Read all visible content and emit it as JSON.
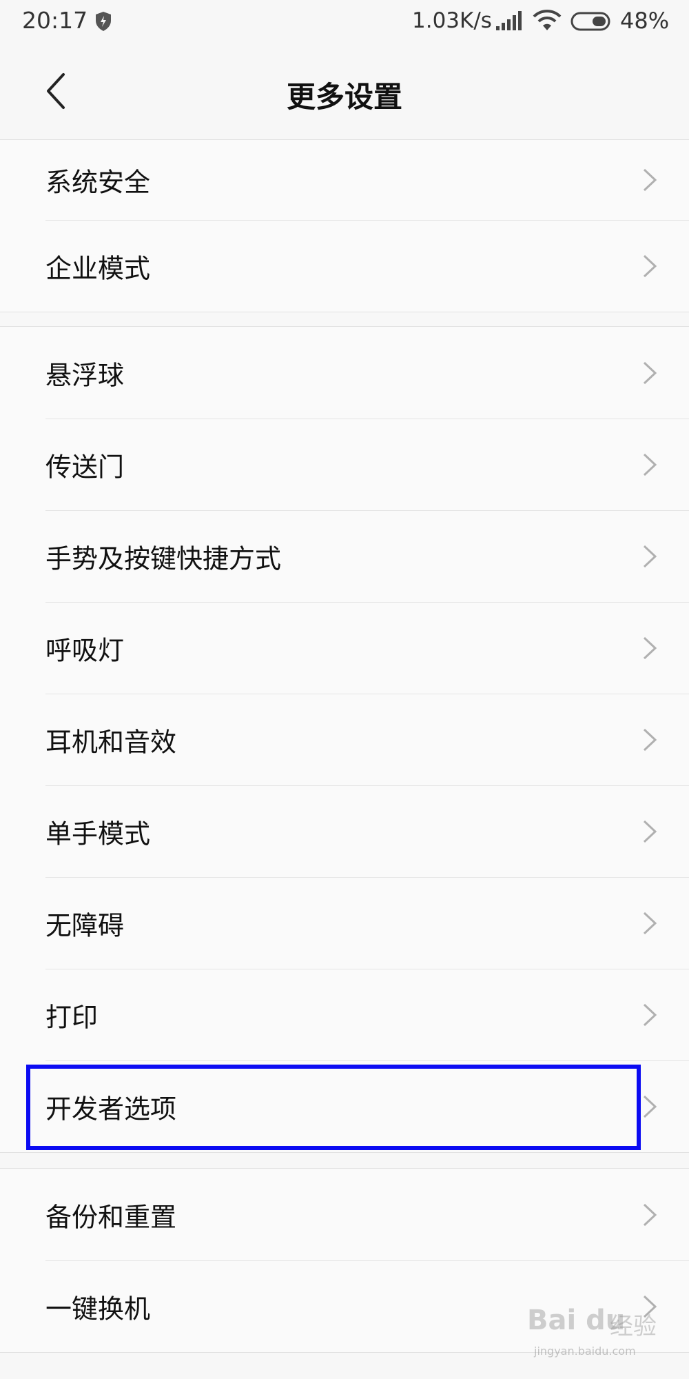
{
  "status_bar": {
    "time": "20:17",
    "network_speed": "1.03K/s",
    "battery_percent": "48%",
    "icons": [
      "shield-bolt-icon",
      "signal-icon",
      "wifi-icon",
      "battery-icon"
    ]
  },
  "header": {
    "title": "更多设置",
    "back_icon": "chevron-left-icon"
  },
  "groups": [
    {
      "items": [
        {
          "label": "系统安全"
        },
        {
          "label": "企业模式"
        }
      ]
    },
    {
      "items": [
        {
          "label": "悬浮球"
        },
        {
          "label": "传送门"
        },
        {
          "label": "手势及按键快捷方式"
        },
        {
          "label": "呼吸灯"
        },
        {
          "label": "耳机和音效"
        },
        {
          "label": "单手模式"
        },
        {
          "label": "无障碍"
        },
        {
          "label": "打印"
        },
        {
          "label": "开发者选项",
          "highlighted": true
        }
      ]
    },
    {
      "items": [
        {
          "label": "备份和重置"
        },
        {
          "label": "一键换机"
        }
      ]
    }
  ],
  "highlight_color": "#0b0bf2",
  "watermark": {
    "brand": "Bai du",
    "cn": "经验",
    "url": "jingyan.baidu.com"
  }
}
